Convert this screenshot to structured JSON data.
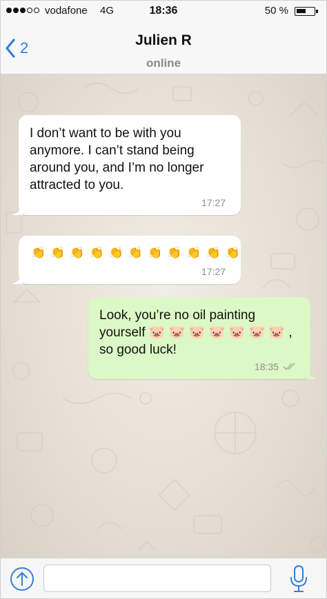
{
  "status_bar": {
    "signal_dots": [
      1,
      1,
      1,
      0,
      0
    ],
    "carrier": "vodafone",
    "network": "4G",
    "time": "18:36",
    "battery_percent_label": "50 %",
    "battery_level": 0.5
  },
  "nav": {
    "back_count": "2",
    "contact_name": "Julien R",
    "contact_status": "online",
    "back_icon": "chevron-left-icon"
  },
  "messages": [
    {
      "direction": "incoming",
      "lines": [
        "I don’t want to be with you",
        "anymore. I can’t stand being",
        "around you, and I’m no longer",
        "attracted to you."
      ],
      "time": "17:27"
    },
    {
      "direction": "incoming",
      "emoji": "👏",
      "emoji_count": 11,
      "time": "17:27"
    },
    {
      "direction": "outgoing",
      "lines": [
        "Look, you’re no oil painting",
        "yourself 🐷 🐷 🐷 🐷 🐷 🐷 🐷 ,",
        "so good luck!"
      ],
      "time": "18:35",
      "read_receipt": "double-check-icon"
    }
  ],
  "input_bar": {
    "message_value": "",
    "attach_icon": "upload-arrow-icon",
    "mic_icon": "microphone-icon"
  },
  "colors": {
    "accent": "#2f7ed8",
    "incoming_bubble": "#ffffff",
    "outgoing_bubble": "#dcf8c6",
    "chat_background": "#e9e2d8",
    "timestamp": "#8c8c8c"
  }
}
